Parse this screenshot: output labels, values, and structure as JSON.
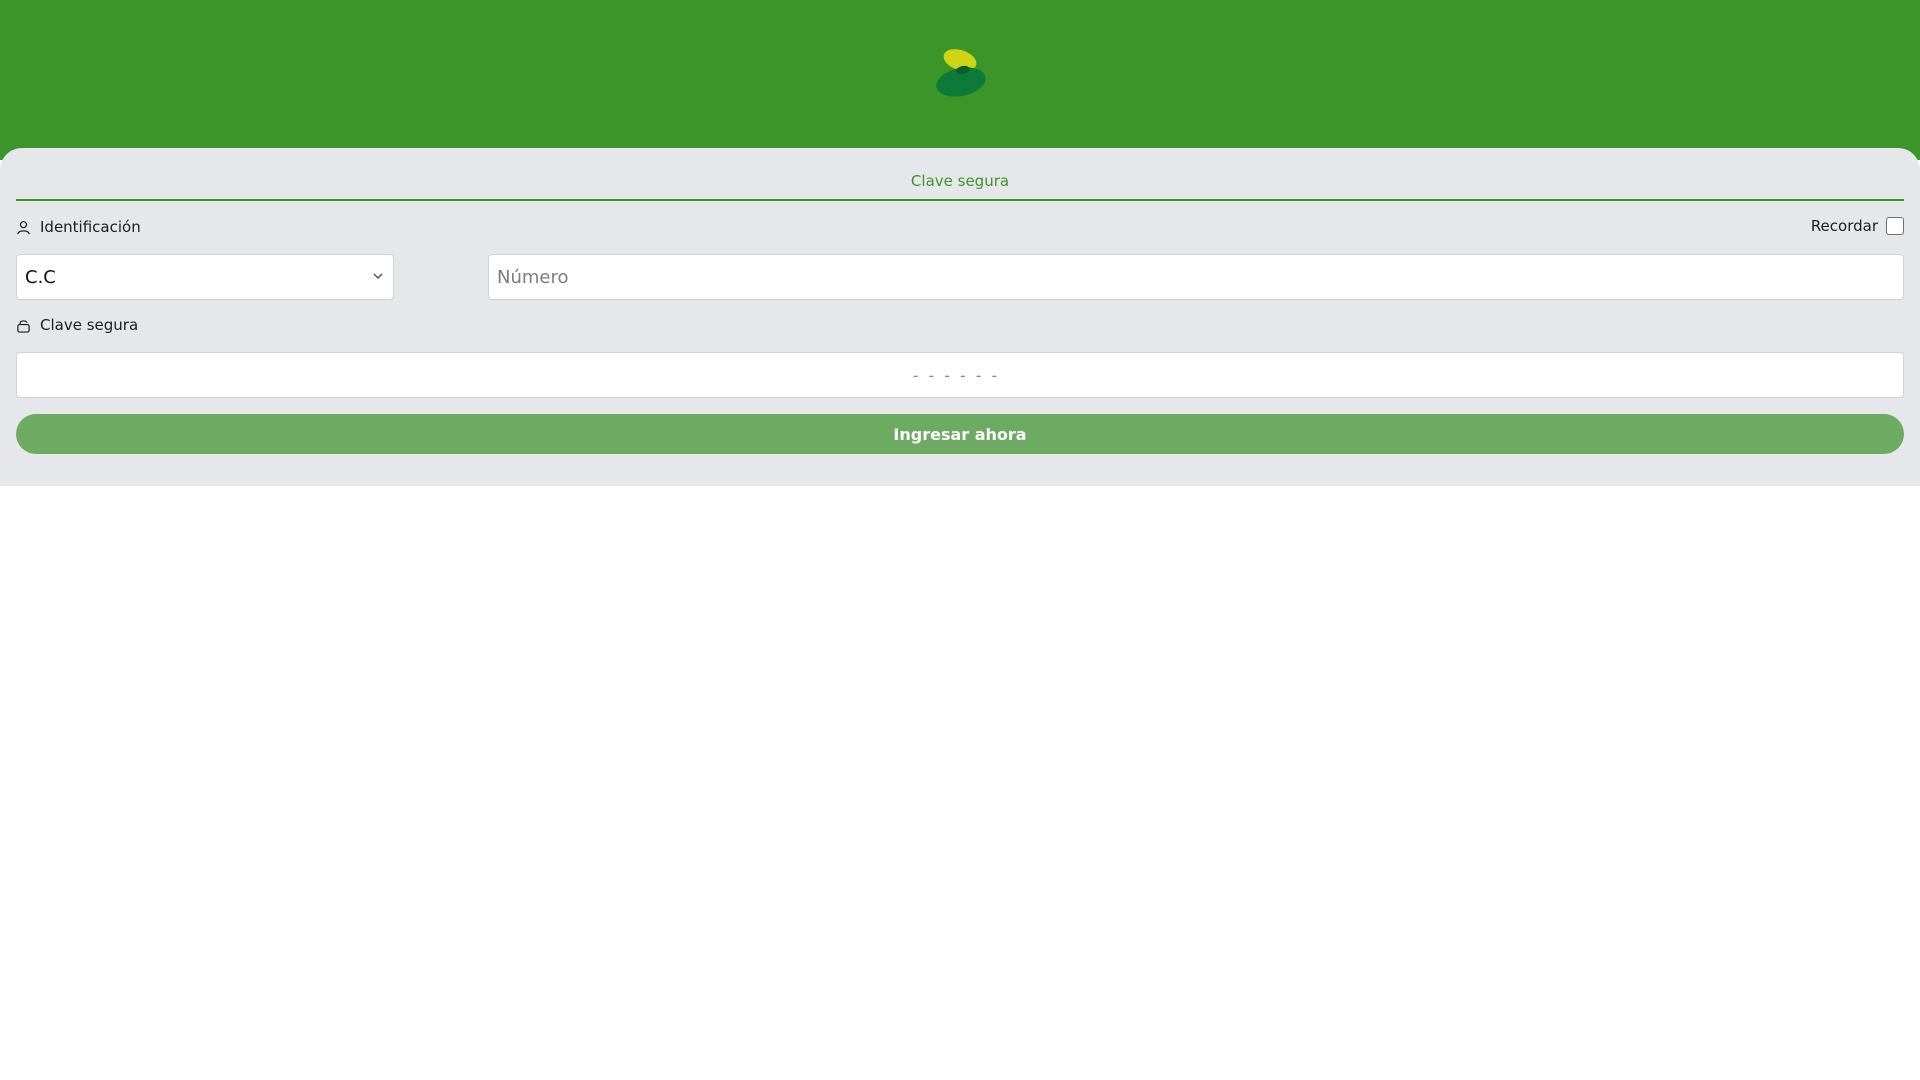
{
  "colors": {
    "brand_green": "#3c9528",
    "panel_bg": "#e6e7eb",
    "button_bg": "#6eab62",
    "logo_yellow": "#cfd413",
    "logo_green": "#0d7a3a"
  },
  "header": {
    "logo_icon": "leaf-logo-icon"
  },
  "login": {
    "tab_label": "Clave segura",
    "identification_label": "Identificación",
    "identification_icon": "user-icon",
    "remember_label": "Recordar",
    "remember_checked": false,
    "doc_type_selected": "C.C",
    "number_placeholder": "Número",
    "key_label": "Clave segura",
    "key_icon": "lock-icon",
    "key_placeholder": "------",
    "submit_label": "Ingresar ahora"
  }
}
